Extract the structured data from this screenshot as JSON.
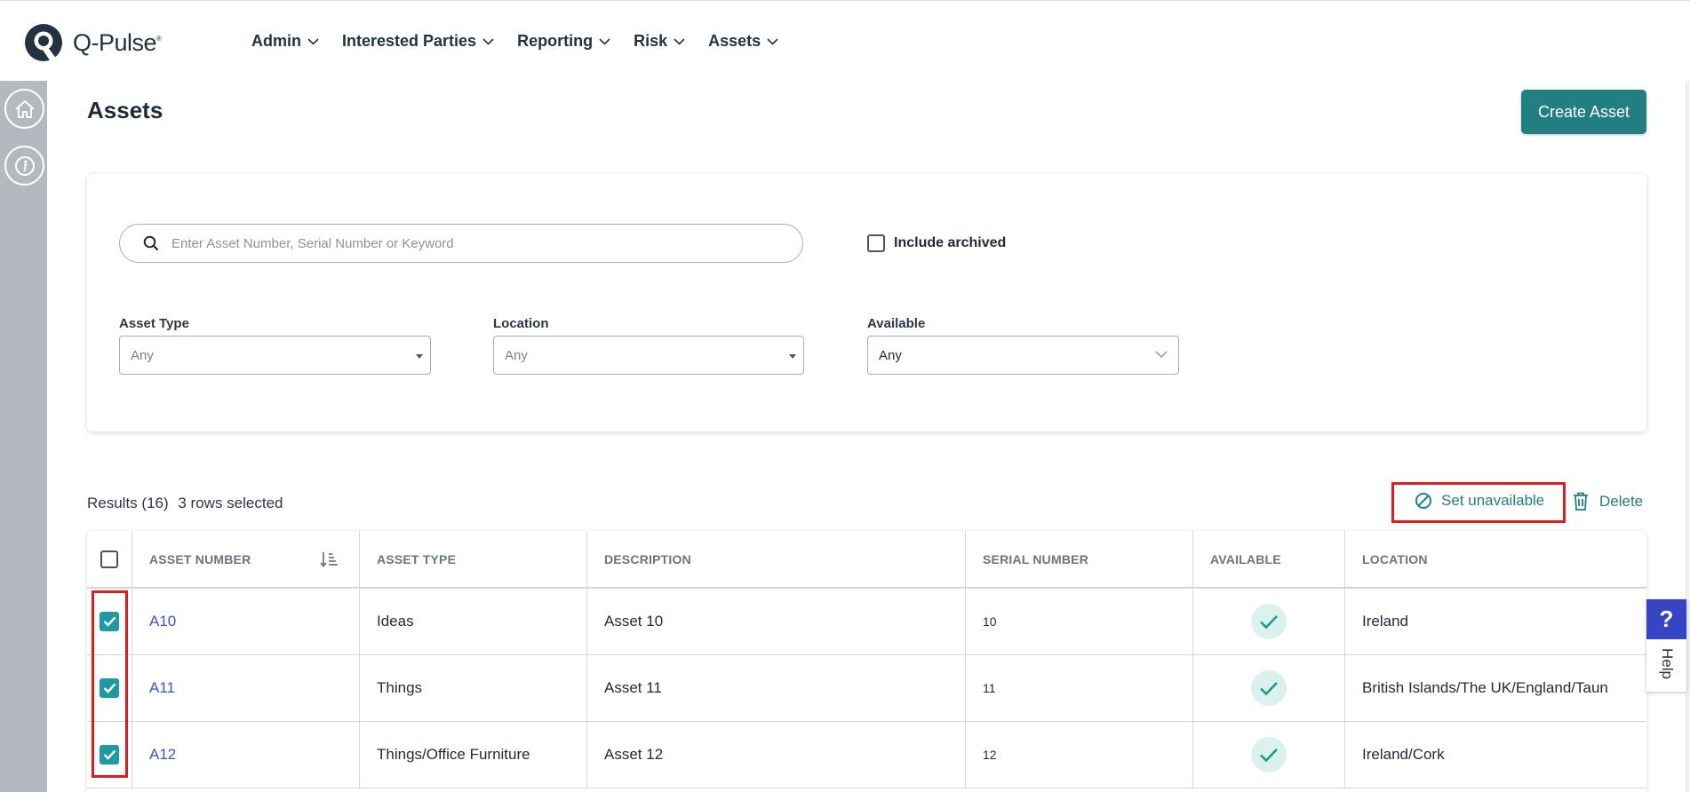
{
  "app": {
    "logo_text": "Q-Pulse"
  },
  "nav": [
    {
      "label": "Admin"
    },
    {
      "label": "Interested Parties"
    },
    {
      "label": "Reporting"
    },
    {
      "label": "Risk"
    },
    {
      "label": "Assets"
    }
  ],
  "page": {
    "title": "Assets",
    "create_button": "Create Asset"
  },
  "filters": {
    "search_placeholder": "Enter Asset Number, Serial Number or Keyword",
    "include_archived": "Include archived",
    "asset_type": {
      "label": "Asset Type",
      "value": "Any"
    },
    "location": {
      "label": "Location",
      "value": "Any"
    },
    "available": {
      "label": "Available",
      "value": "Any"
    }
  },
  "results": {
    "count_text": "Results (16)",
    "selected_text": "3 rows selected",
    "set_unavailable": "Set unavailable",
    "delete": "Delete"
  },
  "table": {
    "columns": [
      "ASSET NUMBER",
      "ASSET TYPE",
      "DESCRIPTION",
      "SERIAL NUMBER",
      "AVAILABLE",
      "LOCATION"
    ],
    "rows": [
      {
        "asset_number": "A10",
        "asset_type": "Ideas",
        "description": "Asset 10",
        "serial": "10",
        "available": true,
        "location": "Ireland",
        "selected": true
      },
      {
        "asset_number": "A11",
        "asset_type": "Things",
        "description": "Asset 11",
        "serial": "11",
        "available": true,
        "location": "British Islands/The UK/England/Taun",
        "selected": true
      },
      {
        "asset_number": "A12",
        "asset_type": "Things/Office Furniture",
        "description": "Asset 12",
        "serial": "12",
        "available": true,
        "location": "Ireland/Cork",
        "selected": true
      }
    ]
  },
  "help": {
    "label": "Help",
    "icon_text": "?"
  },
  "colors": {
    "accent": "#217f82",
    "link": "#3a54c8",
    "highlight": "#dd1c24",
    "sidebar": "#b4b9c0"
  }
}
